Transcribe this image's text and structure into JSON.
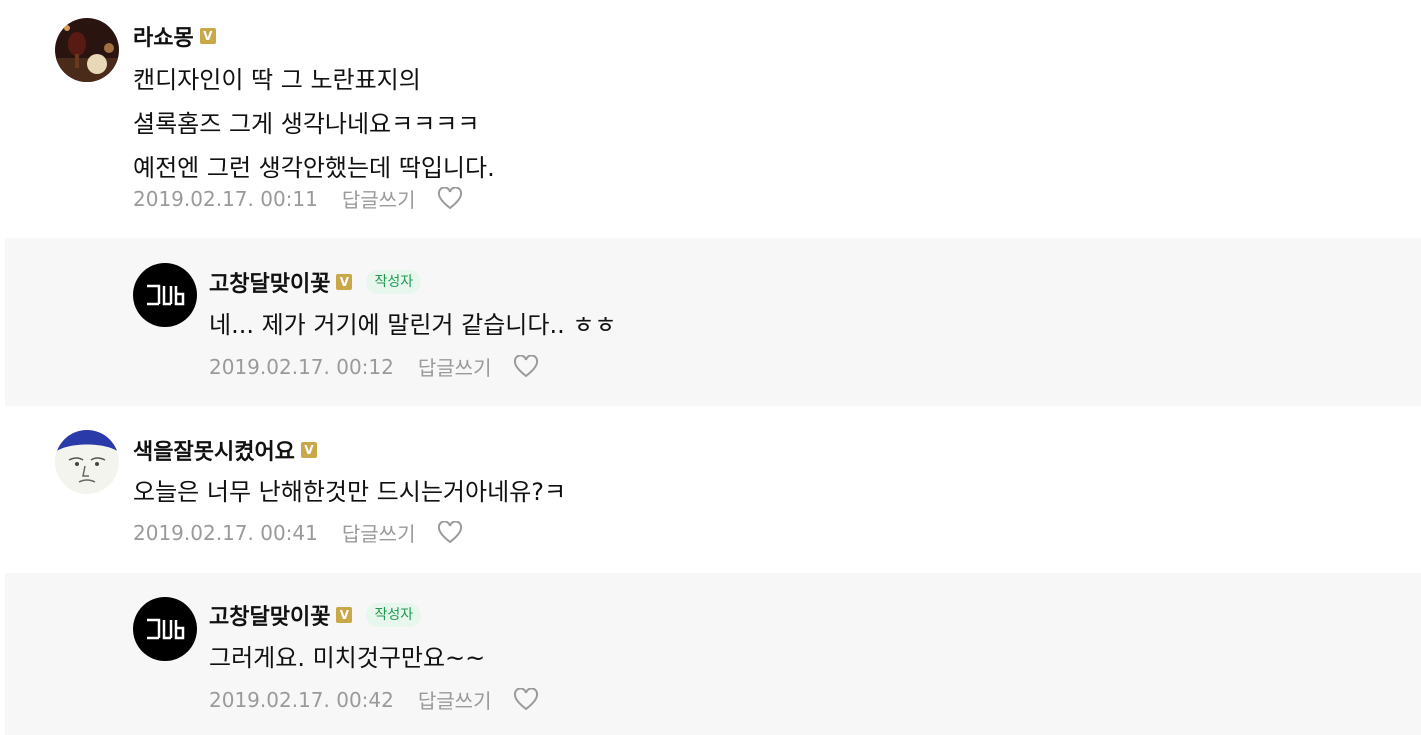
{
  "comments": [
    {
      "author": "라쇼몽",
      "verified_badge": "V",
      "lines": [
        "캔디자인이 딱 그 노란표지의",
        "셜록홈즈 그게 생각나네요ㅋㅋㅋㅋ",
        "예전엔 그런 생각안했는데 딱입니다."
      ],
      "timestamp": "2019.02.17. 00:11",
      "reply_label": "답글쓰기",
      "avatar_icon": "photo-avatar",
      "is_reply": false
    },
    {
      "author": "고창달맞이꽃",
      "verified_badge": "V",
      "author_tag": "작성자",
      "lines": [
        "네... 제가 거기에 말린거 같습니다.. ㅎㅎ"
      ],
      "timestamp": "2019.02.17. 00:12",
      "reply_label": "답글쓰기",
      "avatar_icon": "gd-logo-avatar",
      "is_reply": true
    },
    {
      "author": "색을잘못시켰어요",
      "verified_badge": "V",
      "lines": [
        "오늘은 너무 난해한것만 드시는거아네유?ㅋ"
      ],
      "timestamp": "2019.02.17. 00:41",
      "reply_label": "답글쓰기",
      "avatar_icon": "cartoon-face-avatar",
      "is_reply": false
    },
    {
      "author": "고창달맞이꽃",
      "verified_badge": "V",
      "author_tag": "작성자",
      "lines": [
        "그러게요. 미치것구만요~~"
      ],
      "timestamp": "2019.02.17. 00:42",
      "reply_label": "답글쓰기",
      "avatar_icon": "gd-logo-avatar",
      "is_reply": true
    }
  ],
  "colors": {
    "reply_bg": "#f7f7f7",
    "badge": "#c9a84a",
    "author_tag_bg": "#e8f7ee",
    "author_tag_text": "#1e9b4f",
    "meta_text": "#9a9a9a"
  }
}
